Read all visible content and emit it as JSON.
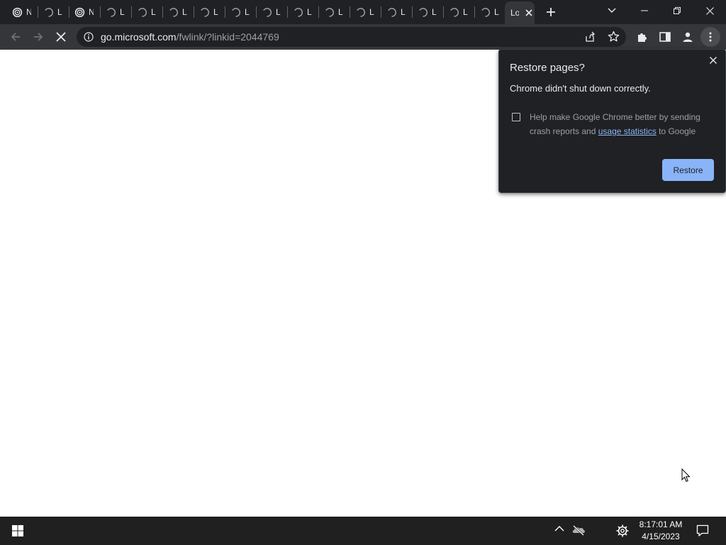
{
  "tabs": [
    {
      "label": "N",
      "icon": "spiral-icon"
    },
    {
      "label": "L",
      "icon": "loading-icon"
    },
    {
      "label": "N",
      "icon": "spiral-icon"
    },
    {
      "label": "L",
      "icon": "loading-icon"
    },
    {
      "label": "L",
      "icon": "loading-icon"
    },
    {
      "label": "L",
      "icon": "loading-icon"
    },
    {
      "label": "L",
      "icon": "loading-icon"
    },
    {
      "label": "L",
      "icon": "loading-icon"
    },
    {
      "label": "L",
      "icon": "loading-icon"
    },
    {
      "label": "L",
      "icon": "loading-icon"
    },
    {
      "label": "L",
      "icon": "loading-icon"
    },
    {
      "label": "L",
      "icon": "loading-icon"
    },
    {
      "label": "L",
      "icon": "loading-icon"
    },
    {
      "label": "L",
      "icon": "loading-icon"
    },
    {
      "label": "L",
      "icon": "loading-icon"
    },
    {
      "label": "L",
      "icon": "loading-icon"
    }
  ],
  "active_tab": {
    "label": "Lo"
  },
  "address": {
    "host": "go.microsoft.com",
    "path": "/fwlink/?linkid=2044769"
  },
  "restore_bubble": {
    "title": "Restore pages?",
    "message": "Chrome didn't shut down correctly.",
    "help_text_before": "Help make Google Chrome better by sending crash reports and ",
    "help_link": "usage statistics",
    "help_text_after": " to Google",
    "restore_label": "Restore"
  },
  "clock": {
    "time": "8:17:01 AM",
    "date": "4/15/2023"
  },
  "colors": {
    "accent": "#8ab4f8",
    "tabstrip": "#202124",
    "toolbar": "#35363a",
    "taskbar": "#202020"
  }
}
